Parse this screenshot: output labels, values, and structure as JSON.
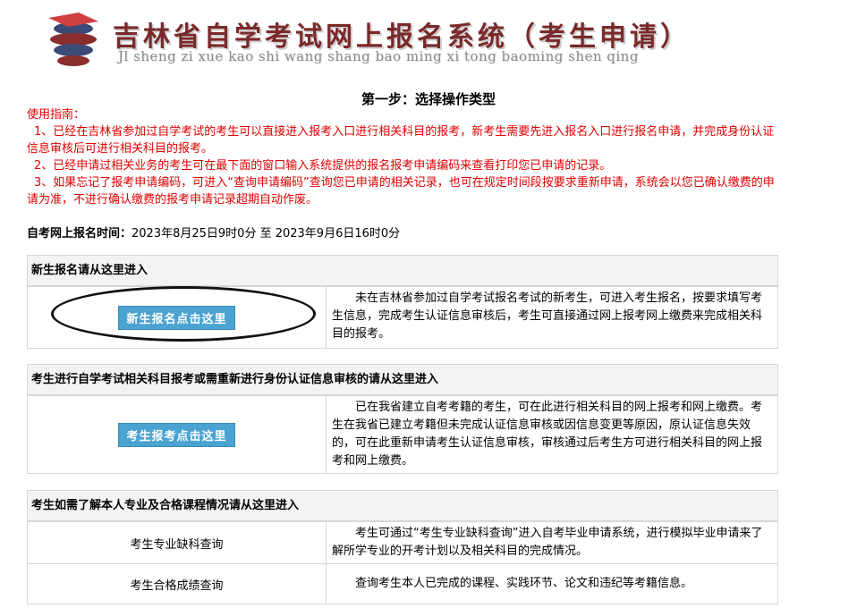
{
  "header": {
    "title": "吉林省自学考试网上报名系统（考生申请）",
    "pinyin": "Jl sheng zi xue kao shi wang shang bao ming xi tong baoming shen qing"
  },
  "step_title": "第一步：选择操作类型",
  "guide": {
    "heading": "使用指南：",
    "items": [
      "1、已经在吉林省参加过自学考试的考生可以直接进入报考入口进行相关科目的报考，新考生需要先进入报名入口进行报名申请，并完成身份认证信息审核后可进行相关科目的报考。",
      "2、已经申请过相关业务的考生可在最下面的窗口输入系统提供的报名报考申请编码来查看打印您已申请的记录。",
      "3、如果忘记了报考申请编码，可进入“查询申请编码”查询您已申请的相关记录，也可在规定时间段按要求重新申请，系统会以您已确认缴费的申请为准，不进行确认缴费的报考申请记录超期自动作废。"
    ]
  },
  "registration_time": {
    "label": "自考网上报名时间：",
    "value": "2023年8月25日9时0分 至 2023年9月6日16时0分"
  },
  "panels": [
    {
      "heading": "新生报名请从这里进入",
      "rows": [
        {
          "action": "新生报名点击这里",
          "description": "未在吉林省参加过自学考试报名考试的新考生，可进入考生报名，按要求填写考生信息，完成考生认证信息审核后，考生可直接通过网上报考网上缴费来完成相关科目的报考。"
        }
      ]
    },
    {
      "heading": "考生进行自学考试相关科目报考或需重新进行身份认证信息审核的请从这里进入",
      "rows": [
        {
          "action": "考生报考点击这里",
          "description": "已在我省建立自考考籍的考生，可在此进行相关科目的网上报考和网上缴费。考生在我省已建立考籍但未完成认证信息审核或因信息变更等原因，原认证信息失效的，可在此重新申请考生认证信息审核，审核通过后考生方可进行相关科目的网上报考和网上缴费。"
        }
      ]
    },
    {
      "heading": "考生如需了解本人专业及合格课程情况请从这里进入",
      "rows": [
        {
          "action": "考生专业缺科查询",
          "description": "考生可通过“考生专业缺科查询”进入自考毕业申请系统，进行模拟毕业申请来了解所学专业的开考计划以及相关科目的完成情况。"
        },
        {
          "action": "考生合格成绩查询",
          "description": "查询考生本人已完成的课程、实践环节、论文和违纪等考籍信息。"
        }
      ]
    }
  ],
  "colors": {
    "guide_text": "#e00000",
    "button_bg": "#4aa3d1",
    "banner_title": "#7a2a2a"
  }
}
